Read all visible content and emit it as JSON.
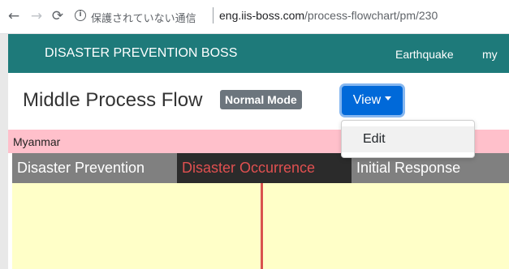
{
  "browser": {
    "back_glyph": "←",
    "forward_glyph": "→",
    "reload_glyph": "⟳",
    "info_glyph": "i",
    "security_text": "保護されていない通信",
    "url_host": "eng.iis-boss.com",
    "url_path": "/process-flowchart/pm/230"
  },
  "navbar": {
    "brand": "DISASTER PREVENTION BOSS",
    "links": [
      "Earthquake",
      "my"
    ],
    "color": "#1e7a7a"
  },
  "header": {
    "title": "Middle Process Flow",
    "mode_badge": "Normal Mode",
    "view_button": "View"
  },
  "dropdown": {
    "items": [
      "Edit"
    ]
  },
  "country_bar": {
    "label": "Myanmar",
    "color": "#ffc0cb"
  },
  "phases": [
    {
      "label": "Disaster Prevention"
    },
    {
      "label": "Disaster Occurrence"
    },
    {
      "label": "Initial Response"
    }
  ],
  "colors": {
    "timeline": "#d9534f",
    "flow_background": "#ffffc8",
    "view_button": "#0069d9"
  }
}
